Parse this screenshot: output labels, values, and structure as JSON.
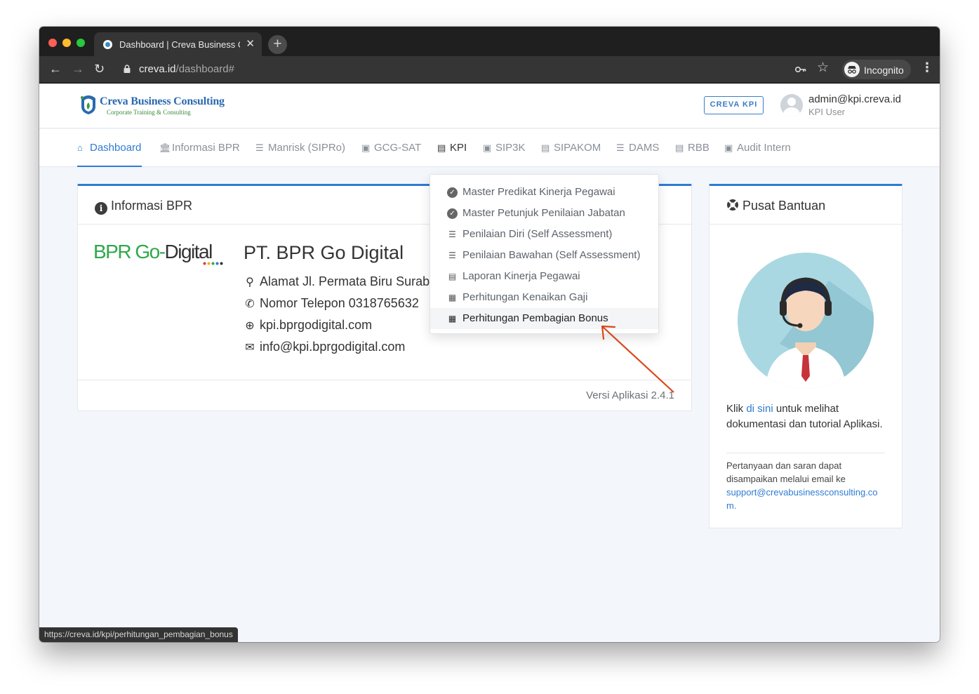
{
  "browser": {
    "tab_title": "Dashboard | Creva Business Consulting",
    "new_tab": "+",
    "tab_close": "✕",
    "url_host": "creva.id",
    "url_path": "/dashboard#",
    "incognito_label": "Incognito",
    "status_url": "https://creva.id/kpi/perhitungan_pembagian_bonus"
  },
  "header": {
    "logo_title": "Creva Business Consulting",
    "logo_subtitle": "Corporate Training & Consulting",
    "product_button": "CREVA KPI",
    "user_email": "admin@kpi.creva.id",
    "user_role": "KPI User"
  },
  "nav": {
    "items": [
      {
        "label": "Dashboard",
        "icon": "home-icon"
      },
      {
        "label": "Informasi BPR",
        "icon": "institution-icon"
      },
      {
        "label": "Manrisk (SIPRo)",
        "icon": "list-check-icon"
      },
      {
        "label": "GCG-SAT",
        "icon": "clipboard-check-icon"
      },
      {
        "label": "KPI",
        "icon": "file-icon"
      },
      {
        "label": "SIP3K",
        "icon": "id-card-icon"
      },
      {
        "label": "SIPAKOM",
        "icon": "book-icon"
      },
      {
        "label": "DAMS",
        "icon": "list-check-icon"
      },
      {
        "label": "RBB",
        "icon": "book-icon"
      },
      {
        "label": "Audit Intern",
        "icon": "clipboard-check-icon"
      }
    ]
  },
  "kpi_menu": {
    "items": [
      {
        "label": "Master Predikat Kinerja Pegawai",
        "icon": "check-circle-icon"
      },
      {
        "label": "Master Petunjuk Penilaian Jabatan",
        "icon": "check-circle-icon"
      },
      {
        "label": "Penilaian Diri (Self Assessment)",
        "icon": "list-check-icon"
      },
      {
        "label": "Penilaian Bawahan (Self Assessment)",
        "icon": "list-check-icon"
      },
      {
        "label": "Laporan Kinerja Pegawai",
        "icon": "book-icon"
      },
      {
        "label": "Perhitungan Kenaikan Gaji",
        "icon": "calculator-icon"
      },
      {
        "label": "Perhitungan Pembagian Bonus",
        "icon": "calculator-icon"
      }
    ]
  },
  "info_card": {
    "title": "Informasi BPR",
    "bpr_logo_green": "BPR Go-",
    "bpr_logo_dark": "Digital",
    "company_name": "PT. BPR Go Digital",
    "address": "Alamat Jl. Permata Biru Surabaya",
    "phone": "Nomor Telepon 0318765632",
    "website": "kpi.bprgodigital.com",
    "email": "info@kpi.bprgodigital.com",
    "version": "Versi Aplikasi 2.4.1"
  },
  "help_card": {
    "title": "Pusat Bantuan",
    "text_before": "Klik ",
    "link": "di sini",
    "text_after": " untuk melihat dokumentasi dan tutorial Aplikasi.",
    "contact_text": "Pertanyaan dan saran dapat disampaikan melalui email ke",
    "support_email": "support@crevabusinessconsulting.com."
  },
  "colors": {
    "accent": "#2f7bd1",
    "bpr_green": "#2ea84a",
    "annotation_arrow": "#d9481a"
  }
}
